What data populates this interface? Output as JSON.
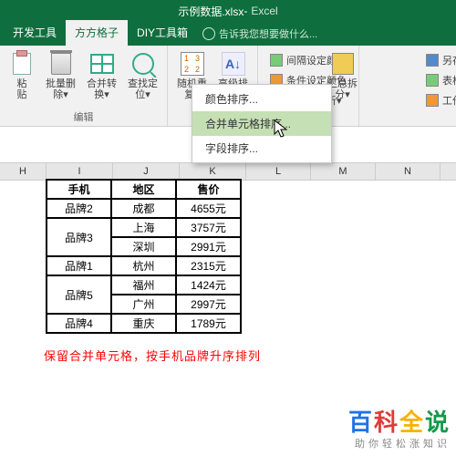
{
  "title": {
    "filename": "示例数据.xlsx",
    "app": "Excel"
  },
  "tabs": {
    "t0": "开发工具",
    "t1": "方方格子",
    "t2": "DIY工具箱",
    "tell": "告诉我您想要做什么..."
  },
  "ribbon": {
    "paste": "粘\n贴",
    "del": "批量删\n除▾",
    "merge": "合并转\n换▾",
    "find": "查找定\n位▾",
    "edit_group": "编辑",
    "rand": "随机重\n复▾",
    "sort": "高级排\n序▾",
    "r1": "间隔设定颜色",
    "r2": "条件设定颜色",
    "r3": "统计与分析▾",
    "sum": "汇总拆\n分▾",
    "sv1": "另存本表",
    "sv2": "表格目录",
    "sv3": "工作表▾"
  },
  "menu": {
    "m1": "颜色排序...",
    "m2": "合并单元格排序...",
    "m3": "字段排序..."
  },
  "cols": {
    "H": "H",
    "I": "I",
    "J": "J",
    "K": "K",
    "L": "L",
    "M": "M",
    "N": "N"
  },
  "chart_data": {
    "type": "table",
    "headers": [
      "手机",
      "地区",
      "售价"
    ],
    "rows": [
      {
        "phone": "品牌2",
        "region": "成都",
        "price": "4655元",
        "span": 1
      },
      {
        "phone": "品牌3",
        "region": "上海",
        "price": "3757元",
        "span": 2
      },
      {
        "phone": "",
        "region": "深圳",
        "price": "2991元",
        "span": 0
      },
      {
        "phone": "品牌1",
        "region": "杭州",
        "price": "2315元",
        "span": 1
      },
      {
        "phone": "品牌5",
        "region": "福州",
        "price": "1424元",
        "span": 2
      },
      {
        "phone": "",
        "region": "广州",
        "price": "2997元",
        "span": 0
      },
      {
        "phone": "品牌4",
        "region": "重庆",
        "price": "1789元",
        "span": 1
      }
    ]
  },
  "note": "保留合并单元格，按手机品牌升序排列",
  "watermark": {
    "b1": "百",
    "b2": "科",
    "b3": "全",
    "b4": "说",
    "sub": "助你轻松涨知识"
  }
}
